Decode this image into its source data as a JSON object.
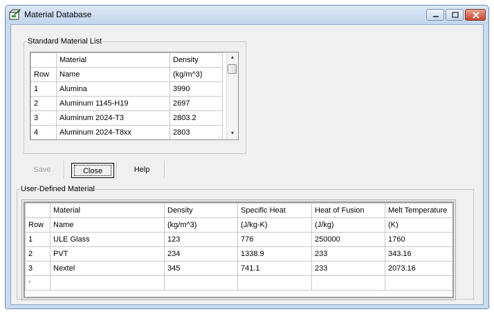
{
  "window": {
    "title": "Material Database",
    "accent_color": "#c9dbf0",
    "controls": {
      "minimize_icon": "minimize-icon",
      "maximize_icon": "maximize-icon",
      "close_icon": "close-icon"
    }
  },
  "standard_list": {
    "legend": "Standard Material List",
    "header_row1": [
      "",
      "Material",
      "Density"
    ],
    "header_row2": [
      "Row",
      "Name",
      "(kg/m^3)"
    ],
    "rows": [
      [
        "1",
        "Alumina",
        "3990"
      ],
      [
        "2",
        "Aluminum 1145-H19",
        "2697"
      ],
      [
        "3",
        "Aluminum 2024-T3",
        "2803.2"
      ],
      [
        "4",
        "Aluminum 2024-T8xx",
        "2803"
      ]
    ]
  },
  "buttons": {
    "save": "Save",
    "close": "Close",
    "help": "Help"
  },
  "user_defined": {
    "legend": "User-Defined Material",
    "header_row1": [
      "",
      "Material",
      "Density",
      "Specific Heat",
      "Heat of Fusion",
      "Melt Temperature"
    ],
    "header_row2": [
      "Row",
      "Name",
      "(kg/m^3)",
      "(J/kg-K)",
      "(J/kg)",
      "(K)"
    ],
    "rows": [
      [
        "1",
        "ULE Glass",
        "123",
        "776",
        "250000",
        "1760"
      ],
      [
        "2",
        "PVT",
        "234",
        "1338.9",
        "233",
        "343.16"
      ],
      [
        "3",
        "Nextel",
        "345",
        "741.1",
        "233",
        "2073.16"
      ]
    ],
    "new_row_marker": "*"
  }
}
